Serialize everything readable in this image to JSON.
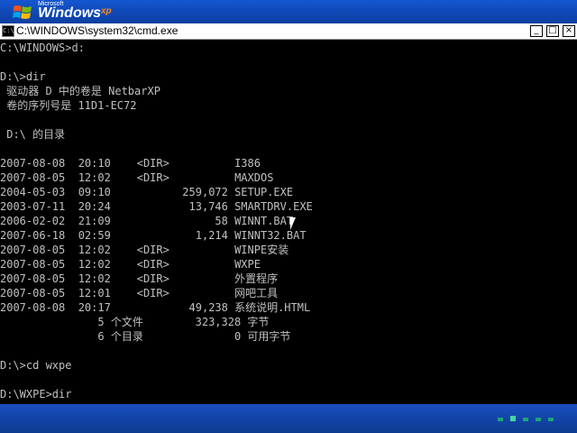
{
  "brand": {
    "small": "Microsoft",
    "name": "Windows",
    "xp": "xp",
    "colors": {
      "red": "#f25022",
      "green": "#7fba00",
      "blue": "#00a4ef",
      "yellow": "#ffb900"
    }
  },
  "window": {
    "title": "C:\\WINDOWS\\system32\\cmd.exe",
    "minimize_icon": "minimize-icon",
    "maximize_icon": "maximize-icon",
    "close_icon": "close-icon"
  },
  "console": {
    "lines": [
      "C:\\WINDOWS>d:",
      "",
      "D:\\>dir",
      " 驱动器 D 中的卷是 NetbarXP",
      " 卷的序列号是 11D1-EC72",
      "",
      " D:\\ 的目录",
      "",
      "2007-08-08  20:10    <DIR>          I386",
      "2007-08-05  12:02    <DIR>          MAXDOS",
      "2004-05-03  09:10           259,072 SETUP.EXE",
      "2003-07-11  20:24            13,746 SMARTDRV.EXE",
      "2006-02-02  21:09                58 WINNT.BAT",
      "2007-06-18  02:59             1,214 WINNT32.BAT",
      "2007-08-05  12:02    <DIR>          WINPE安装",
      "2007-08-05  12:02    <DIR>          WXPE",
      "2007-08-05  12:02    <DIR>          外置程序",
      "2007-08-05  12:01    <DIR>          网吧工具",
      "2007-08-08  20:17            49,238 系统说明.HTML",
      "               5 个文件        323,328 字节",
      "               6 个目录              0 可用字节",
      "",
      "D:\\>cd wxpe",
      "",
      "D:\\WXPE>dir"
    ]
  },
  "taskbar": {
    "tray_count": 5
  }
}
